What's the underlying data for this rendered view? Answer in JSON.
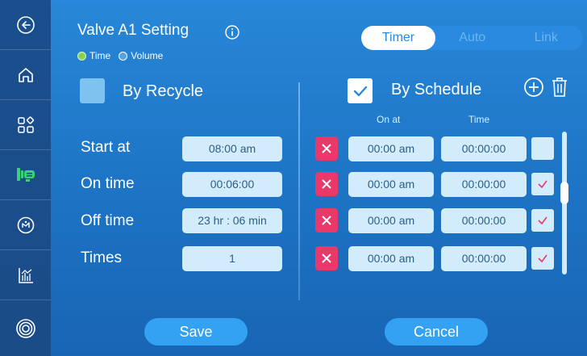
{
  "sidebar": {
    "items": [
      {
        "icon": "back-arrow-icon"
      },
      {
        "icon": "home-icon"
      },
      {
        "icon": "grid-icon"
      },
      {
        "icon": "valve-icon",
        "active": true
      },
      {
        "icon": "pump-icon"
      },
      {
        "icon": "chart-icon"
      },
      {
        "icon": "target-icon"
      }
    ]
  },
  "header": {
    "title": "Valve A1 Setting",
    "mode_time": "Time",
    "mode_volume": "Volume"
  },
  "tabs": {
    "timer": "Timer",
    "auto": "Auto",
    "link": "Link",
    "active": "timer"
  },
  "recycle": {
    "label": "By Recycle",
    "checked": false,
    "start_at_label": "Start at",
    "start_at_value": "08:00 am",
    "on_time_label": "On time",
    "on_time_value": "00:06:00",
    "off_time_label": "Off time",
    "off_time_value": "23 hr : 06 min",
    "times_label": "Times",
    "times_value": "1"
  },
  "schedule": {
    "label": "By Schedule",
    "checked": true,
    "col_on_at": "On at",
    "col_time": "Time",
    "rows": [
      {
        "on_at": "00:00 am",
        "time": "00:00:00",
        "enabled": false
      },
      {
        "on_at": "00:00 am",
        "time": "00:00:00",
        "enabled": true
      },
      {
        "on_at": "00:00 am",
        "time": "00:00:00",
        "enabled": true
      },
      {
        "on_at": "00:00 am",
        "time": "00:00:00",
        "enabled": true
      }
    ]
  },
  "footer": {
    "save": "Save",
    "cancel": "Cancel"
  },
  "colors": {
    "accent": "#34a2f2",
    "delete": "#e9386a",
    "field_bg": "#d3ecfb",
    "check_mark": "#e9386a",
    "active_sidebar": "#3cd07e"
  }
}
